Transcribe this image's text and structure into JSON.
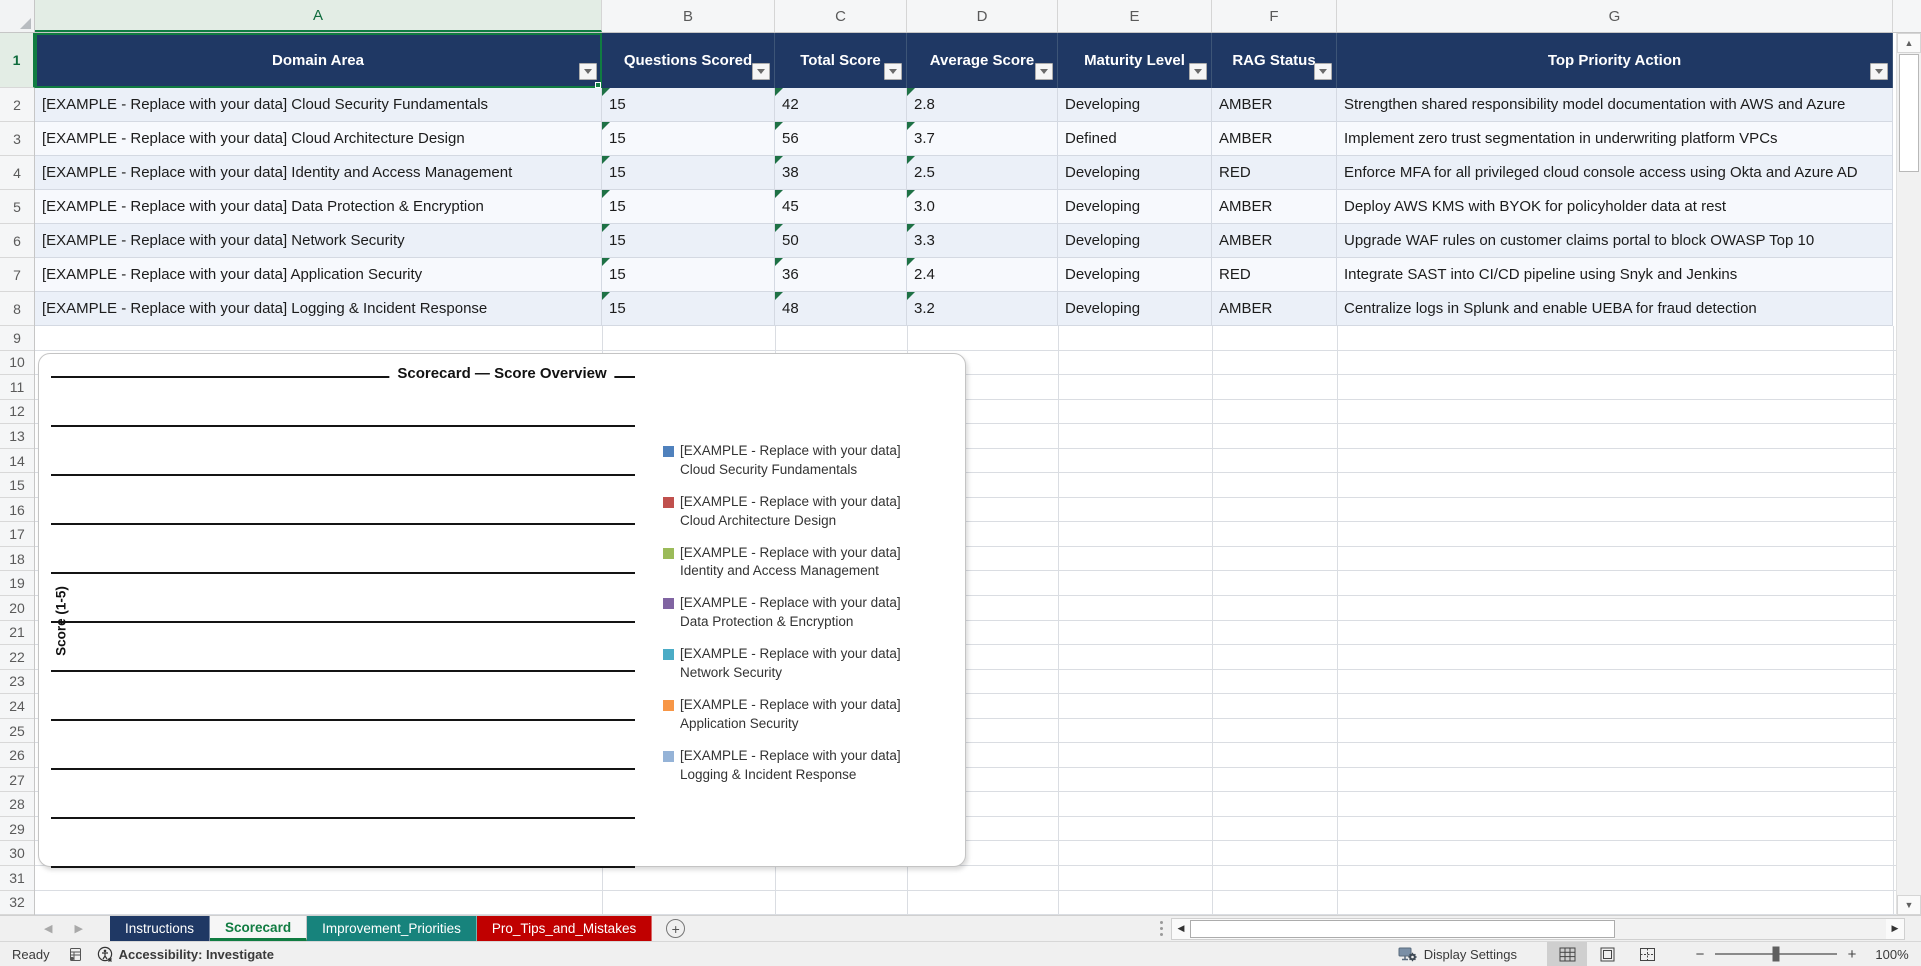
{
  "column_letters": [
    "A",
    "B",
    "C",
    "D",
    "E",
    "F",
    "G"
  ],
  "table": {
    "headers": {
      "domain": "Domain Area",
      "questions": "Questions Scored",
      "total": "Total Score",
      "average": "Average Score",
      "maturity": "Maturity Level",
      "rag": "RAG Status",
      "action": "Top Priority Action"
    },
    "rows": [
      {
        "domain": "[EXAMPLE - Replace with your data] Cloud Security Fundamentals",
        "questions": "15",
        "total": "42",
        "average": "2.8",
        "maturity": "Developing",
        "rag": "AMBER",
        "action": "Strengthen shared responsibility model documentation with AWS and Azure"
      },
      {
        "domain": "[EXAMPLE - Replace with your data] Cloud Architecture Design",
        "questions": "15",
        "total": "56",
        "average": "3.7",
        "maturity": "Defined",
        "rag": "AMBER",
        "action": "Implement zero trust segmentation in underwriting platform VPCs"
      },
      {
        "domain": "[EXAMPLE - Replace with your data] Identity and Access Management",
        "questions": "15",
        "total": "38",
        "average": "2.5",
        "maturity": "Developing",
        "rag": "RED",
        "action": "Enforce MFA for all privileged cloud console access using Okta and Azure AD"
      },
      {
        "domain": "[EXAMPLE - Replace with your data] Data Protection & Encryption",
        "questions": "15",
        "total": "45",
        "average": "3.0",
        "maturity": "Developing",
        "rag": "AMBER",
        "action": "Deploy AWS KMS with BYOK for policyholder data at rest"
      },
      {
        "domain": "[EXAMPLE - Replace with your data] Network Security",
        "questions": "15",
        "total": "50",
        "average": "3.3",
        "maturity": "Developing",
        "rag": "AMBER",
        "action": "Upgrade WAF rules on customer claims portal to block OWASP Top 10"
      },
      {
        "domain": "[EXAMPLE - Replace with your data] Application Security",
        "questions": "15",
        "total": "36",
        "average": "2.4",
        "maturity": "Developing",
        "rag": "RED",
        "action": "Integrate SAST into CI/CD pipeline using Snyk and Jenkins"
      },
      {
        "domain": "[EXAMPLE - Replace with your data] Logging & Incident Response",
        "questions": "15",
        "total": "48",
        "average": "3.2",
        "maturity": "Developing",
        "rag": "AMBER",
        "action": "Centralize logs in Splunk and enable UEBA for fraud detection"
      }
    ],
    "visible_row_numbers": {
      "first": 1,
      "last": 32
    }
  },
  "chart": {
    "title": "Scorecard — Score Overview",
    "ylabel": "Score (1-5)",
    "gridline_count": 11,
    "legend": [
      {
        "label": "[EXAMPLE - Replace with your data] Cloud Security Fundamentals",
        "color": "#4F81BD"
      },
      {
        "label": "[EXAMPLE - Replace with your data] Cloud Architecture Design",
        "color": "#C0504D"
      },
      {
        "label": "[EXAMPLE - Replace with your data] Identity and Access Management",
        "color": "#9BBB59"
      },
      {
        "label": "[EXAMPLE - Replace with your data] Data Protection & Encryption",
        "color": "#8064A2"
      },
      {
        "label": "[EXAMPLE - Replace with your data] Network Security",
        "color": "#4BACC6"
      },
      {
        "label": "[EXAMPLE - Replace with your data] Application Security",
        "color": "#F79646"
      },
      {
        "label": "[EXAMPLE - Replace with your data] Logging & Incident Response",
        "color": "#95B3D7"
      }
    ]
  },
  "chart_data": {
    "type": "bar",
    "title": "Scorecard — Score Overview",
    "ylabel": "Score (1-5)",
    "ylim_label": "1-5",
    "series": [
      {
        "name": "[EXAMPLE - Replace with your data] Cloud Security Fundamentals",
        "color": "#4F81BD"
      },
      {
        "name": "[EXAMPLE - Replace with your data] Cloud Architecture Design",
        "color": "#C0504D"
      },
      {
        "name": "[EXAMPLE - Replace with your data] Identity and Access Management",
        "color": "#9BBB59"
      },
      {
        "name": "[EXAMPLE - Replace with your data] Data Protection & Encryption",
        "color": "#8064A2"
      },
      {
        "name": "[EXAMPLE - Replace with your data] Network Security",
        "color": "#4BACC6"
      },
      {
        "name": "[EXAMPLE - Replace with your data] Application Security",
        "color": "#F79646"
      },
      {
        "name": "[EXAMPLE - Replace with your data] Logging & Incident Response",
        "color": "#95B3D7"
      }
    ],
    "values_rendered": false,
    "note": "Plot area shows only horizontal gridlines; no bars, axis tick labels or data values are drawn",
    "legend_position": "right",
    "grid": true
  },
  "sheet_tabs": [
    {
      "label": "Instructions",
      "bg": "#1F3864",
      "fg": "#FFFFFF"
    },
    {
      "label": "Scorecard",
      "bg": "#F6F6F6",
      "fg": "#107C41",
      "active_class": "active"
    },
    {
      "label": "Improvement_Priorities",
      "bg": "#17837C",
      "fg": "#FFFFFF"
    },
    {
      "label": "Pro_Tips_and_Mistakes",
      "bg": "#C00000",
      "fg": "#FFFFFF"
    }
  ],
  "tab_bar": {
    "new_sheet_glyph": "+"
  },
  "status_bar": {
    "mode": "Ready",
    "accessibility": "Accessibility: Investigate",
    "display_settings": "Display Settings",
    "zoom_level": "100%",
    "zoom_minus": "−",
    "zoom_plus": "+"
  },
  "icons": {
    "up_arrow": "▲",
    "down_arrow": "▼",
    "left_arrow": "◀",
    "right_arrow": "◀",
    "nav_left": "◀",
    "nav_right": "▶"
  },
  "colors": {
    "table_header_bg": "#1F3864",
    "selection_green": "#107C41",
    "row_band_dark": "#EBF0F8",
    "row_band_light": "#F7F9FD"
  }
}
